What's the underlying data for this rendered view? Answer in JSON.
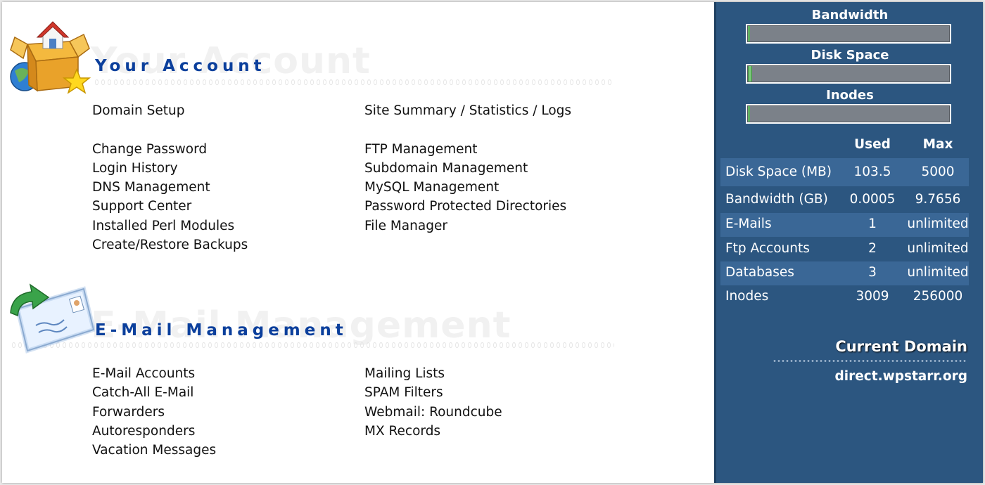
{
  "account": {
    "title": "Your Account",
    "links_left": [
      "Domain Setup",
      "",
      "Change Password",
      "Login History",
      "DNS Management",
      "Support Center",
      "Installed Perl Modules",
      "Create/Restore Backups"
    ],
    "links_right": [
      "Site Summary / Statistics / Logs",
      "",
      "FTP Management",
      "Subdomain Management",
      "MySQL Management",
      "Password Protected Directories",
      "File Manager"
    ]
  },
  "email": {
    "title": "E-Mail Management",
    "links_left": [
      "E-Mail Accounts",
      "Catch-All E-Mail",
      "Forwarders",
      "Autoresponders",
      "Vacation Messages"
    ],
    "links_right": [
      "Mailing Lists",
      "SPAM Filters",
      "Webmail: Roundcube",
      "MX Records"
    ]
  },
  "sidebar": {
    "meters": [
      {
        "label": "Bandwidth",
        "fill_fraction": 0.0001
      },
      {
        "label": "Disk Space",
        "fill_fraction": 0.021
      },
      {
        "label": "Inodes",
        "fill_fraction": 0.012
      }
    ],
    "stats": {
      "headers": [
        "",
        "Used",
        "Max"
      ],
      "rows": [
        {
          "name": "Disk Space (MB)",
          "used": "103.5",
          "max": "5000"
        },
        {
          "name": "Bandwidth (GB)",
          "used": "0.0005",
          "max": "9.7656"
        },
        {
          "name": "E-Mails",
          "used": "1",
          "max": "unlimited"
        },
        {
          "name": "Ftp Accounts",
          "used": "2",
          "max": "unlimited"
        },
        {
          "name": "Databases",
          "used": "3",
          "max": "unlimited"
        },
        {
          "name": "Inodes",
          "used": "3009",
          "max": "256000"
        }
      ]
    },
    "current_domain_label": "Current Domain",
    "current_domain": "direct.wpstarr.org"
  },
  "colors": {
    "sidebar_bg": "#2c5680",
    "sidebar_row_shade": "#3a6796",
    "header_blue": "#0b3f9c"
  },
  "icons": {
    "account": "house-box-globe-star-icon",
    "email": "envelope-arrow-icon"
  }
}
